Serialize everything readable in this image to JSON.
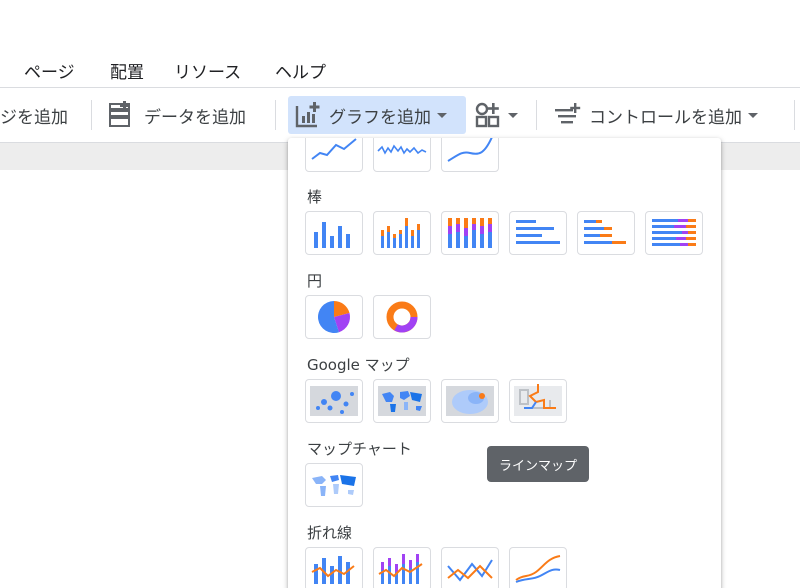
{
  "menu": [
    "ページ",
    "配置",
    "リソース",
    "ヘルプ"
  ],
  "toolbar": {
    "add_page": "ジを追加",
    "add_data": "データを追加",
    "add_chart": "グラフを追加",
    "add_control": "コントロールを追加"
  },
  "chart_menu": {
    "sections": [
      "棒",
      "円",
      "Google マップ",
      "マップチャート",
      "折れ線"
    ]
  },
  "tooltip": "ラインマップ",
  "colors": {
    "blue": "#4285f4",
    "orange": "#fa7b17",
    "purple": "#a142f4",
    "active_bg": "#d2e3fc"
  }
}
